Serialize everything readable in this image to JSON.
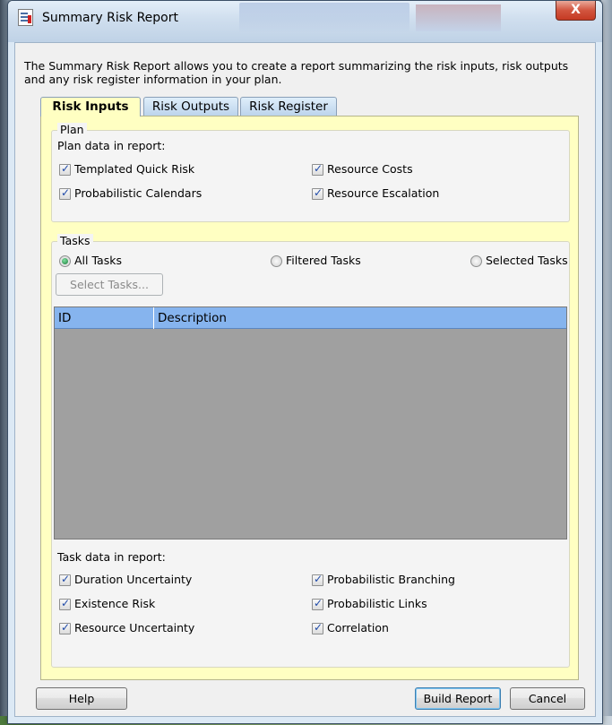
{
  "window": {
    "title": "Summary Risk Report",
    "close_label": "X"
  },
  "intro_text": "The Summary Risk Report allows you to create a report summarizing the risk inputs, risk outputs and any risk register information in your plan.",
  "tabs": [
    {
      "label": "Risk Inputs",
      "active": true
    },
    {
      "label": "Risk Outputs",
      "active": false
    },
    {
      "label": "Risk Register",
      "active": false
    }
  ],
  "plan": {
    "group_title": "Plan",
    "section_label": "Plan data in report:",
    "options": [
      {
        "label": "Templated Quick Risk",
        "checked": true
      },
      {
        "label": "Resource Costs",
        "checked": true
      },
      {
        "label": "Probabilistic Calendars",
        "checked": true
      },
      {
        "label": "Resource Escalation",
        "checked": true
      }
    ]
  },
  "tasks": {
    "group_title": "Tasks",
    "scope_options": [
      {
        "label": "All Tasks",
        "selected": true
      },
      {
        "label": "Filtered Tasks",
        "selected": false
      },
      {
        "label": "Selected Tasks",
        "selected": false
      }
    ],
    "select_button": "Select Tasks...",
    "grid_columns": [
      "ID",
      "Description"
    ],
    "task_data_label": "Task data in report:",
    "task_options": [
      {
        "label": "Duration Uncertainty",
        "checked": true
      },
      {
        "label": "Probabilistic Branching",
        "checked": true
      },
      {
        "label": "Existence Risk",
        "checked": true
      },
      {
        "label": "Probabilistic Links",
        "checked": true
      },
      {
        "label": "Resource Uncertainty",
        "checked": true
      },
      {
        "label": "Correlation",
        "checked": true
      }
    ]
  },
  "footer": {
    "help_label": "Help",
    "build_label": "Build Report",
    "cancel_label": "Cancel"
  },
  "colors": {
    "active_tab": "#ffffc2",
    "grid_header": "#86b4ee",
    "grid_body": "#a0a0a0",
    "close_button": "#c53a23"
  }
}
